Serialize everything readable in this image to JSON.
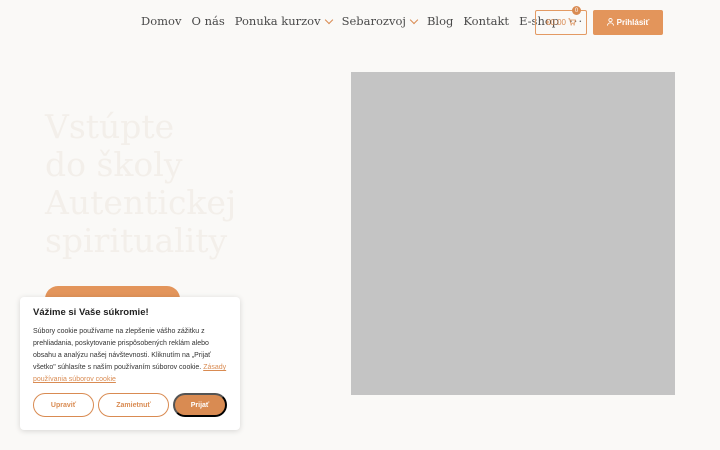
{
  "nav": {
    "items": [
      {
        "label": "Domov",
        "dropdown": false
      },
      {
        "label": "O nás",
        "dropdown": false
      },
      {
        "label": "Ponuka kurzov",
        "dropdown": true
      },
      {
        "label": "Sebarozvoj",
        "dropdown": true
      },
      {
        "label": "Blog",
        "dropdown": false
      },
      {
        "label": "Kontakt",
        "dropdown": false
      },
      {
        "label": "E-shop",
        "dropdown": false
      }
    ],
    "more": "···"
  },
  "cart": {
    "amount": "€0.00",
    "count": "0",
    "icon": "cart-icon"
  },
  "login": {
    "label": "Prihlásiť",
    "icon": "user-icon"
  },
  "hero": {
    "title_lines": [
      "Vstúpte",
      "do školy",
      "Autentickej",
      "spirituality"
    ]
  },
  "cookie": {
    "title": "Vážime si Vaše súkromie!",
    "text": "Súbory cookie používame na zlepšenie vášho zážitku z prehliadania, poskytovanie prispôsobených reklám alebo obsahu a analýzu našej návštevnosti. Kliknutím na „Prijať všetko\" súhlasíte s naším používaním súborov cookie.",
    "link": "Zásady používania súborov cookie",
    "buttons": {
      "customize": "Upraviť",
      "reject": "Zamietnuť",
      "accept": "Prijať"
    }
  },
  "colors": {
    "accent": "#e3955b",
    "background": "#faf9f7",
    "image_placeholder": "#c4c4c4"
  }
}
